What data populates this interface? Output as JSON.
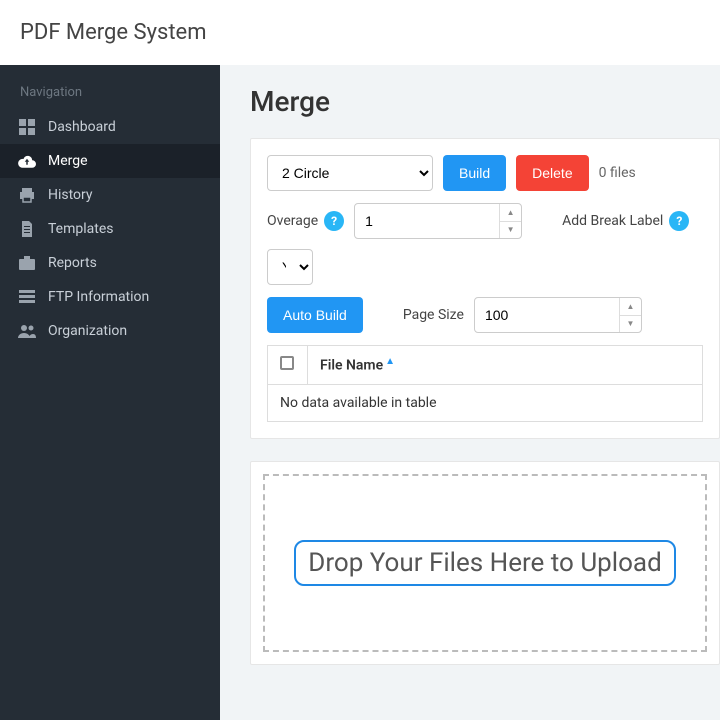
{
  "app": {
    "title": "PDF Merge System"
  },
  "sidebar": {
    "header": "Navigation",
    "items": [
      {
        "label": "Dashboard"
      },
      {
        "label": "Merge"
      },
      {
        "label": "History"
      },
      {
        "label": "Templates"
      },
      {
        "label": "Reports"
      },
      {
        "label": "FTP Information"
      },
      {
        "label": "Organization"
      }
    ]
  },
  "page": {
    "title": "Merge"
  },
  "toolbar": {
    "template_selected": "2 Circle",
    "build_label": "Build",
    "delete_label": "Delete",
    "file_count_text": "0 files",
    "overage_label": "Overage",
    "overage_value": "1",
    "break_label": "Add Break Label",
    "break_value": "Yes",
    "auto_build_label": "Auto Build",
    "page_size_label": "Page Size",
    "page_size_value": "100"
  },
  "table": {
    "col_checkbox": "",
    "col_filename": "File Name",
    "empty_text": "No data available in table"
  },
  "dropzone": {
    "text": "Drop Your Files Here to Upload"
  }
}
